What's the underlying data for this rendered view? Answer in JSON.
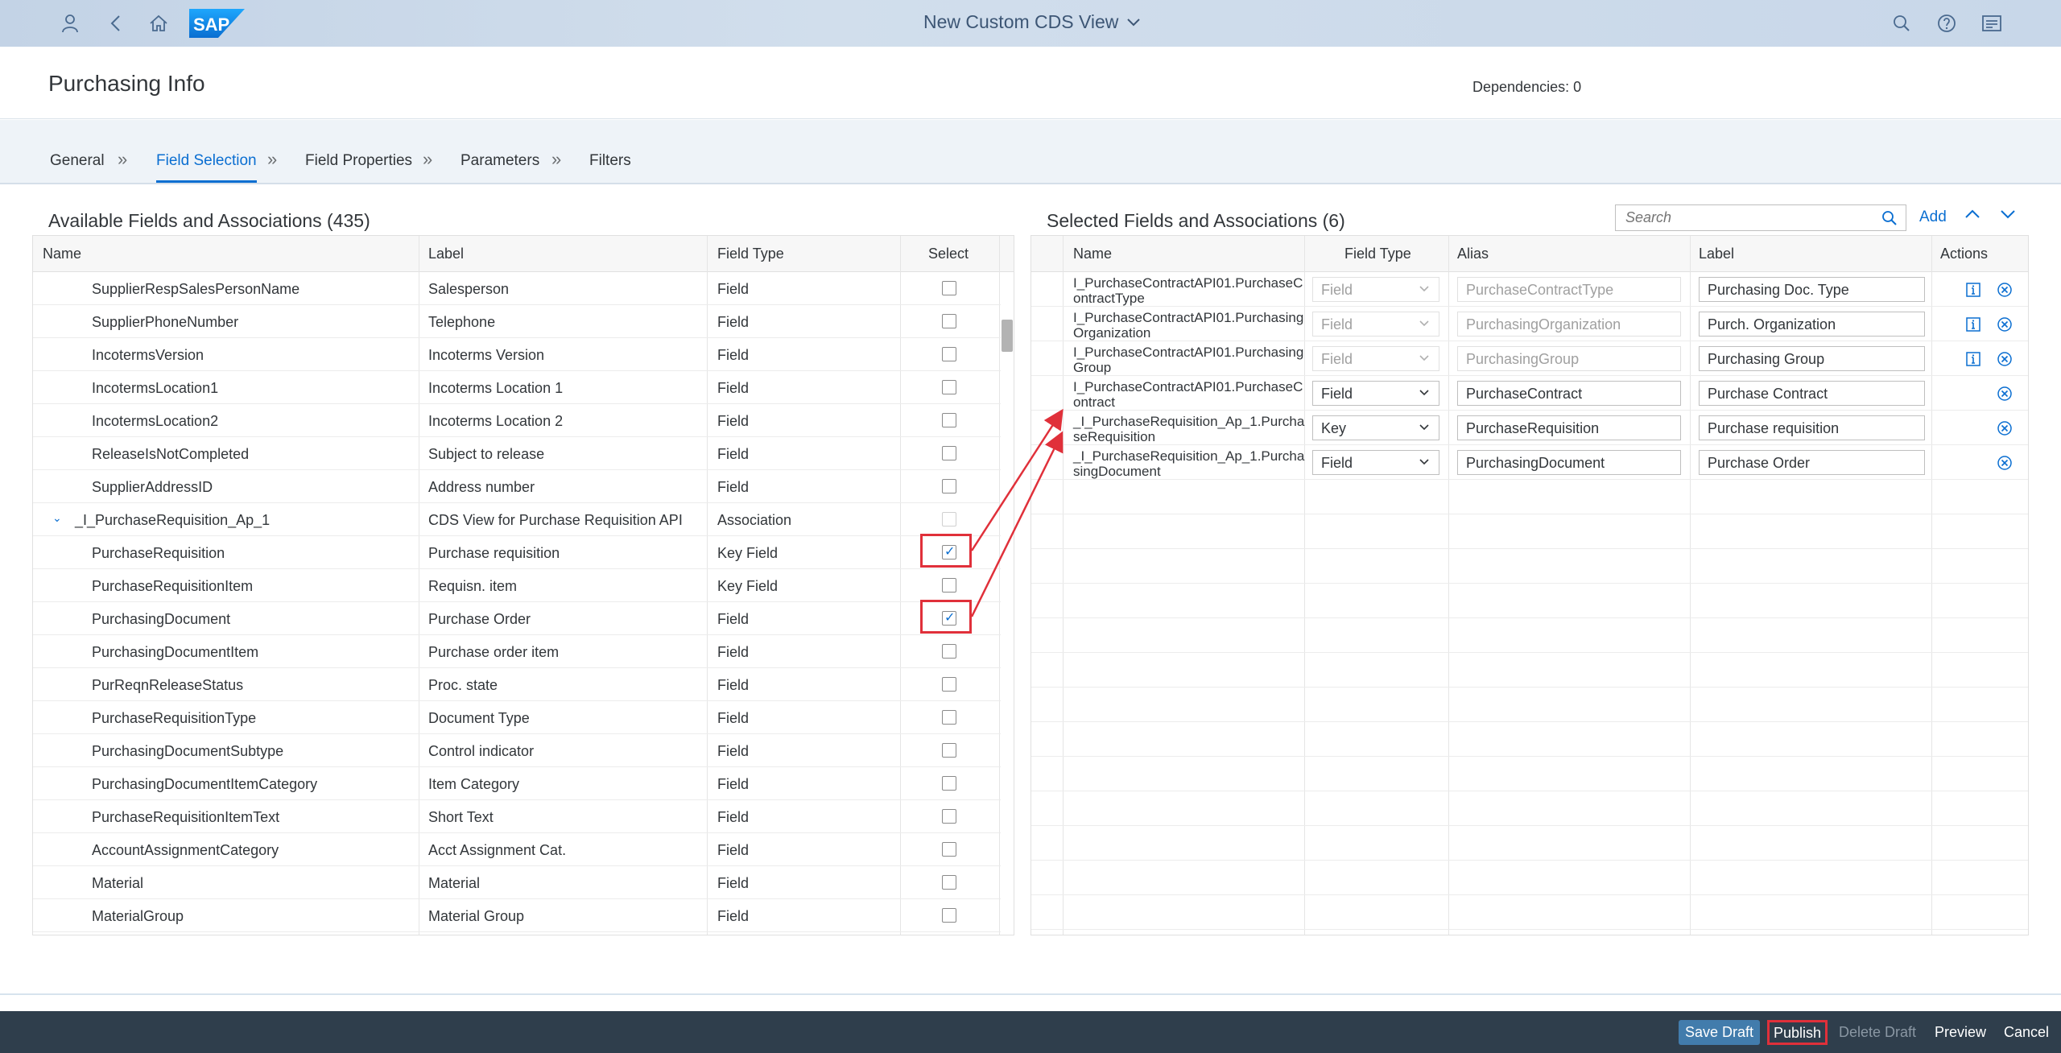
{
  "shell": {
    "title": "New Custom CDS View",
    "logo_text": "SAP"
  },
  "header": {
    "title": "Purchasing Info",
    "dependencies": "Dependencies: 0"
  },
  "tabs": [
    {
      "label": "General"
    },
    {
      "label": "Field Selection"
    },
    {
      "label": "Field Properties"
    },
    {
      "label": "Parameters"
    },
    {
      "label": "Filters"
    }
  ],
  "tab_separator": "»",
  "left_panel": {
    "title": "Available Fields and Associations (435)",
    "columns": {
      "name": "Name",
      "label": "Label",
      "field_type": "Field Type",
      "select": "Select"
    },
    "rows": [
      {
        "name": "SupplierRespSalesPersonName",
        "label": "Salesperson",
        "type": "Field",
        "checked": false
      },
      {
        "name": "SupplierPhoneNumber",
        "label": "Telephone",
        "type": "Field",
        "checked": false
      },
      {
        "name": "IncotermsVersion",
        "label": "Incoterms Version",
        "type": "Field",
        "checked": false
      },
      {
        "name": "IncotermsLocation1",
        "label": "Incoterms Location 1",
        "type": "Field",
        "checked": false
      },
      {
        "name": "IncotermsLocation2",
        "label": "Incoterms Location 2",
        "type": "Field",
        "checked": false
      },
      {
        "name": "ReleaseIsNotCompleted",
        "label": "Subject to release",
        "type": "Field",
        "checked": false
      },
      {
        "name": "SupplierAddressID",
        "label": "Address number",
        "type": "Field",
        "checked": false
      },
      {
        "name": "_I_PurchaseRequisition_Ap_1",
        "label": "CDS View for Purchase Requisition API",
        "type": "Association",
        "checked": false,
        "association": true
      },
      {
        "name": "PurchaseRequisition",
        "label": "Purchase requisition",
        "type": "Key Field",
        "checked": true
      },
      {
        "name": "PurchaseRequisitionItem",
        "label": "Requisn. item",
        "type": "Key Field",
        "checked": false
      },
      {
        "name": "PurchasingDocument",
        "label": "Purchase Order",
        "type": "Field",
        "checked": true
      },
      {
        "name": "PurchasingDocumentItem",
        "label": "Purchase order item",
        "type": "Field",
        "checked": false
      },
      {
        "name": "PurReqnReleaseStatus",
        "label": "Proc. state",
        "type": "Field",
        "checked": false
      },
      {
        "name": "PurchaseRequisitionType",
        "label": "Document Type",
        "type": "Field",
        "checked": false
      },
      {
        "name": "PurchasingDocumentSubtype",
        "label": "Control indicator",
        "type": "Field",
        "checked": false
      },
      {
        "name": "PurchasingDocumentItemCategory",
        "label": "Item Category",
        "type": "Field",
        "checked": false
      },
      {
        "name": "PurchaseRequisitionItemText",
        "label": "Short Text",
        "type": "Field",
        "checked": false
      },
      {
        "name": "AccountAssignmentCategory",
        "label": "Acct Assignment Cat.",
        "type": "Field",
        "checked": false
      },
      {
        "name": "Material",
        "label": "Material",
        "type": "Field",
        "checked": false
      },
      {
        "name": "MaterialGroup",
        "label": "Material Group",
        "type": "Field",
        "checked": false
      }
    ]
  },
  "right_panel": {
    "title": "Selected Fields and Associations (6)",
    "search_placeholder": "Search",
    "add_label": "Add",
    "columns": {
      "name": "Name",
      "field_type": "Field Type",
      "alias": "Alias",
      "label": "Label",
      "actions": "Actions"
    },
    "rows": [
      {
        "name": "I_PurchaseContractAPI01.PurchaseContractType",
        "field_type": "Field",
        "alias": "PurchaseContractType",
        "label": "Purchasing Doc. Type",
        "editable": false,
        "info": true
      },
      {
        "name": "I_PurchaseContractAPI01.PurchasingOrganization",
        "field_type": "Field",
        "alias": "PurchasingOrganization",
        "label": "Purch. Organization",
        "editable": false,
        "info": true
      },
      {
        "name": "I_PurchaseContractAPI01.PurchasingGroup",
        "field_type": "Field",
        "alias": "PurchasingGroup",
        "label": "Purchasing Group",
        "editable": false,
        "info": true
      },
      {
        "name": "I_PurchaseContractAPI01.PurchaseContract",
        "field_type": "Field",
        "alias": "PurchaseContract",
        "label": "Purchase Contract",
        "editable": true,
        "info": false
      },
      {
        "name": "_I_PurchaseRequisition_Ap_1.PurchaseRequisition",
        "field_type": "Key",
        "alias": "PurchaseRequisition",
        "label": "Purchase requisition",
        "editable": true,
        "info": false
      },
      {
        "name": "_I_PurchaseRequisition_Ap_1.PurchasingDocument",
        "field_type": "Field",
        "alias": "PurchasingDocument",
        "label": "Purchase Order",
        "editable": true,
        "info": false
      }
    ]
  },
  "footer": {
    "save_draft": "Save Draft",
    "publish": "Publish",
    "delete_draft": "Delete Draft",
    "preview": "Preview",
    "cancel": "Cancel"
  },
  "colors": {
    "accent": "#0a6ed1",
    "highlight": "#e0303a",
    "footer_bg": "#2f3e4c",
    "primary_button": "#427cac"
  }
}
